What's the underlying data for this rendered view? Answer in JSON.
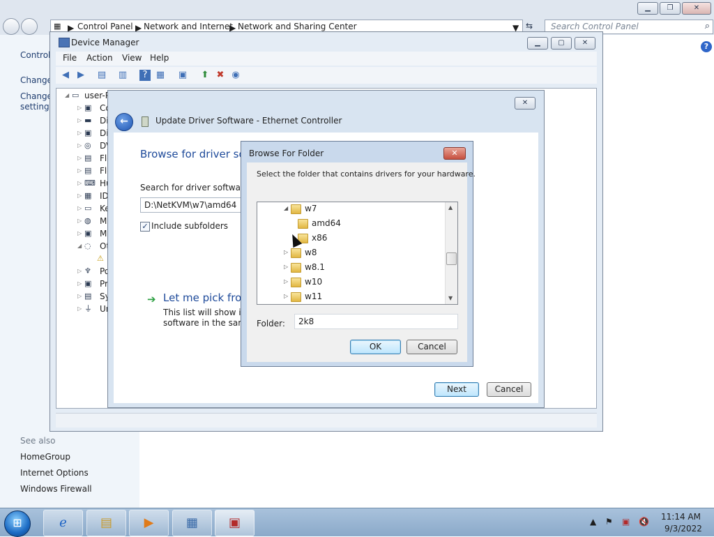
{
  "control_panel": {
    "breadcrumb": [
      "Control Panel",
      "Network and Internet",
      "Network and Sharing Center"
    ],
    "search_placeholder": "Search Control Panel",
    "left_links": [
      "Control",
      "Change",
      "Change",
      "settings"
    ],
    "see_also_label": "See also",
    "see_also_links": [
      "HomeGroup",
      "Internet Options",
      "Windows Firewall"
    ]
  },
  "device_manager": {
    "title": "Device Manager",
    "menu": [
      "File",
      "Action",
      "View",
      "Help"
    ],
    "root": "user-P",
    "tree_items": [
      "Co",
      "Di",
      "Di",
      "DV",
      "Flo",
      "Flo",
      "Hu",
      "ID",
      "Ke",
      "Mi",
      "Mo",
      "Ot",
      "",
      "Po",
      "Pr",
      "Sy",
      "Ur"
    ]
  },
  "wizard": {
    "title": "Update Driver Software - Ethernet Controller",
    "heading": "Browse for driver sof",
    "search_label": "Search for driver software in",
    "path_value": "D:\\NetKVM\\w7\\amd64",
    "include_subfolders": "Include subfolders",
    "pick_label": "Let me pick from",
    "desc_line1": "This list will show inst",
    "desc_line2": "software in the same",
    "next": "Next",
    "cancel": "Cancel"
  },
  "browse_folder": {
    "title": "Browse For Folder",
    "prompt": "Select the folder that contains drivers for your hardware.",
    "folders": [
      {
        "name": "w7",
        "expanded": true
      },
      {
        "name": "amd64",
        "expanded": false
      },
      {
        "name": "x86",
        "expanded": false
      },
      {
        "name": "w8",
        "expanded": false
      },
      {
        "name": "w8.1",
        "expanded": false
      },
      {
        "name": "w10",
        "expanded": false
      },
      {
        "name": "w11",
        "expanded": false
      }
    ],
    "folder_label": "Folder:",
    "folder_value": "2k8",
    "ok": "OK",
    "cancel": "Cancel"
  },
  "taskbar": {
    "time": "11:14 AM",
    "date": "9/3/2022"
  }
}
